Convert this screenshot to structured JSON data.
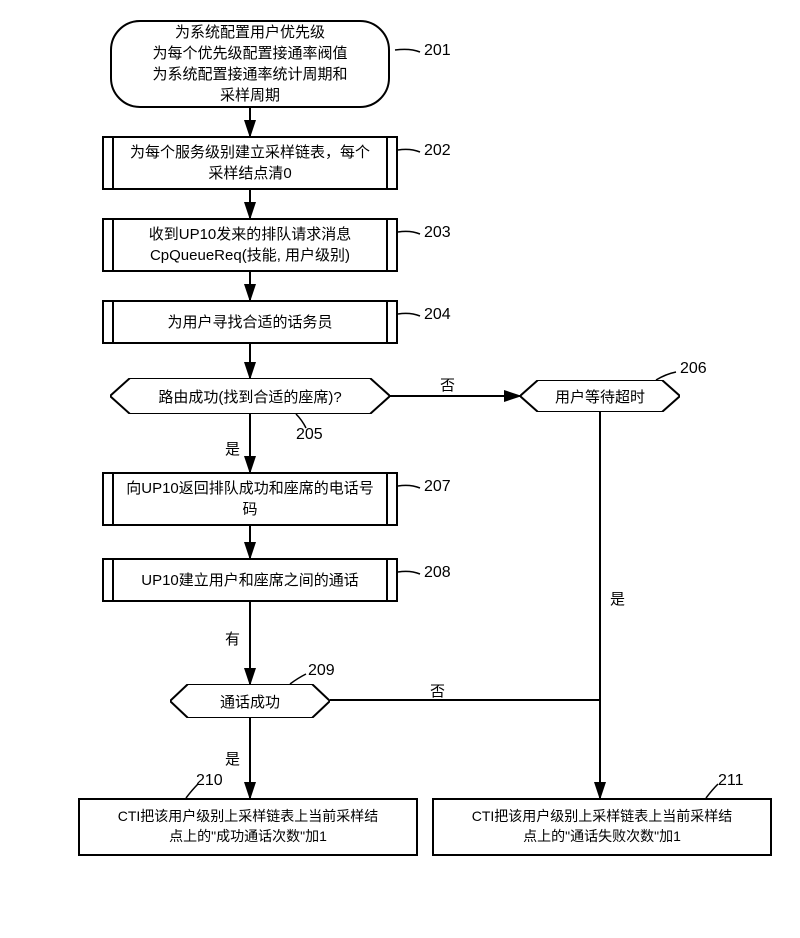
{
  "nodes": {
    "n201": "为系统配置用户优先级\n为每个优先级配置接通率阀值\n为系统配置接通率统计周期和\n采样周期",
    "n202": "为每个服务级别建立采样链表，每个\n采样结点清0",
    "n203": "收到UP10发来的排队请求消息\nCpQueueReq(技能, 用户级别)",
    "n204": "为用户寻找合适的话务员",
    "n205": "路由成功(找到合适的座席)?",
    "n206": "用户等待超时",
    "n207": "向UP10返回排队成功和座席的电话号\n码",
    "n208": "UP10建立用户和座席之间的通话",
    "n209": "通话成功",
    "n210": "CTI把该用户级别上采样链表上当前采样结\n点上的\"成功通话次数\"加1",
    "n211": "CTI把该用户级别上采样链表上当前采样结\n点上的\"通话失败次数\"加1"
  },
  "labels": {
    "l201": "201",
    "l202": "202",
    "l203": "203",
    "l204": "204",
    "l205": "205",
    "l206": "206",
    "l207": "207",
    "l208": "208",
    "l209": "209",
    "l210": "210",
    "l211": "211"
  },
  "edges": {
    "yes": "是",
    "no": "否",
    "has": "有"
  }
}
